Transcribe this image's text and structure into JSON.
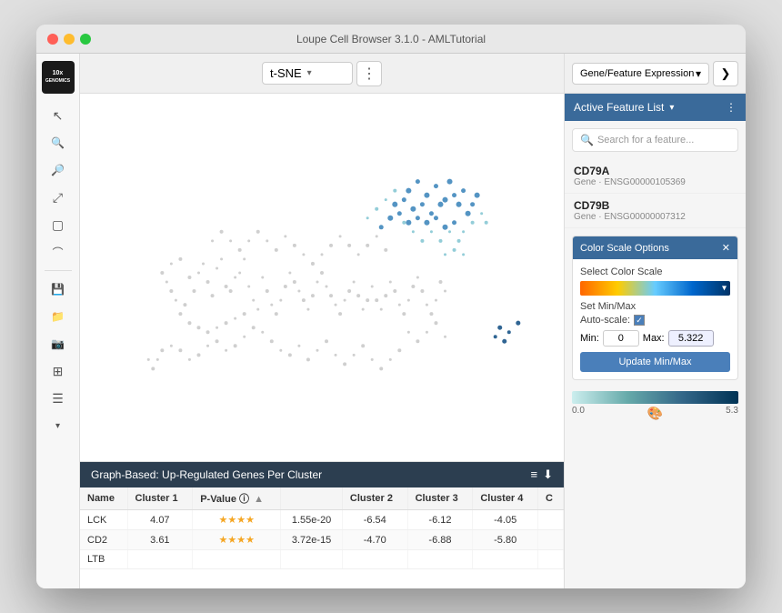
{
  "window": {
    "title": "Loupe Cell Browser 3.1.0 - AMLTutorial"
  },
  "logo": {
    "line1": "10x",
    "line2": "GENOMICS"
  },
  "toolbar": {
    "view_label": "t-SNE",
    "view_arrow": "▾"
  },
  "right_header": {
    "mode_label": "Gene/Feature Expression",
    "mode_arrow": "▾",
    "nav_next": "❯"
  },
  "active_feature": {
    "header": "Active Feature List",
    "header_arrow": "▾",
    "menu_icon": "⋮",
    "search_placeholder": "Search for a feature...",
    "features": [
      {
        "name": "CD79A",
        "sub": "Gene · ENSG00000105369"
      },
      {
        "name": "CD79B",
        "sub": "Gene · ENSG00000007312"
      }
    ]
  },
  "color_scale": {
    "header": "Color Scale Options",
    "close": "✕",
    "select_label": "Select Color Scale",
    "minmax_label": "Set Min/Max",
    "autoscale_label": "Auto-scale:",
    "autoscale_checked": true,
    "min_label": "Min:",
    "min_value": "0",
    "max_label": "Max:",
    "max_value": "5.322",
    "update_button": "Update Min/Max",
    "scale_min": "0.0",
    "scale_max": "5.3"
  },
  "bottom_panel": {
    "title": "Graph-Based: Up-Regulated Genes Per Cluster",
    "icon1": "≡",
    "icon2": "⬇",
    "columns": [
      "Name",
      "Cluster 1",
      "P-Value ⓘ",
      "",
      "Cluster 2",
      "Cluster 3",
      "Cluster 4",
      "C"
    ],
    "rows": [
      {
        "name": "LCK",
        "c1": "4.07",
        "stars": "★★★★",
        "pval": "1.55e-20",
        "c2": "-6.54",
        "c3": "-6.12",
        "c4": "-4.05"
      },
      {
        "name": "CD2",
        "c1": "3.61",
        "stars": "★★★★",
        "pval": "3.72e-15",
        "c2": "-4.70",
        "c3": "-6.88",
        "c4": "-5.80"
      },
      {
        "name": "LTB",
        "c1": "",
        "stars": "",
        "pval": "",
        "c2": "",
        "c3": "",
        "c4": ""
      }
    ]
  },
  "sidebar_icons": [
    {
      "id": "cursor",
      "icon": "↖",
      "label": "Select"
    },
    {
      "id": "zoom-in",
      "icon": "🔍",
      "label": "Zoom In"
    },
    {
      "id": "zoom-out",
      "icon": "🔎",
      "label": "Zoom Out"
    },
    {
      "id": "fit",
      "icon": "⤢",
      "label": "Fit"
    },
    {
      "id": "rect-select",
      "icon": "▢",
      "label": "Rectangle Select"
    },
    {
      "id": "lasso",
      "icon": "○",
      "label": "Lasso"
    },
    {
      "id": "save",
      "icon": "💾",
      "label": "Save"
    },
    {
      "id": "folder",
      "icon": "📁",
      "label": "Open"
    },
    {
      "id": "screenshot",
      "icon": "📷",
      "label": "Screenshot"
    },
    {
      "id": "grid",
      "icon": "⊞",
      "label": "Grid"
    }
  ]
}
